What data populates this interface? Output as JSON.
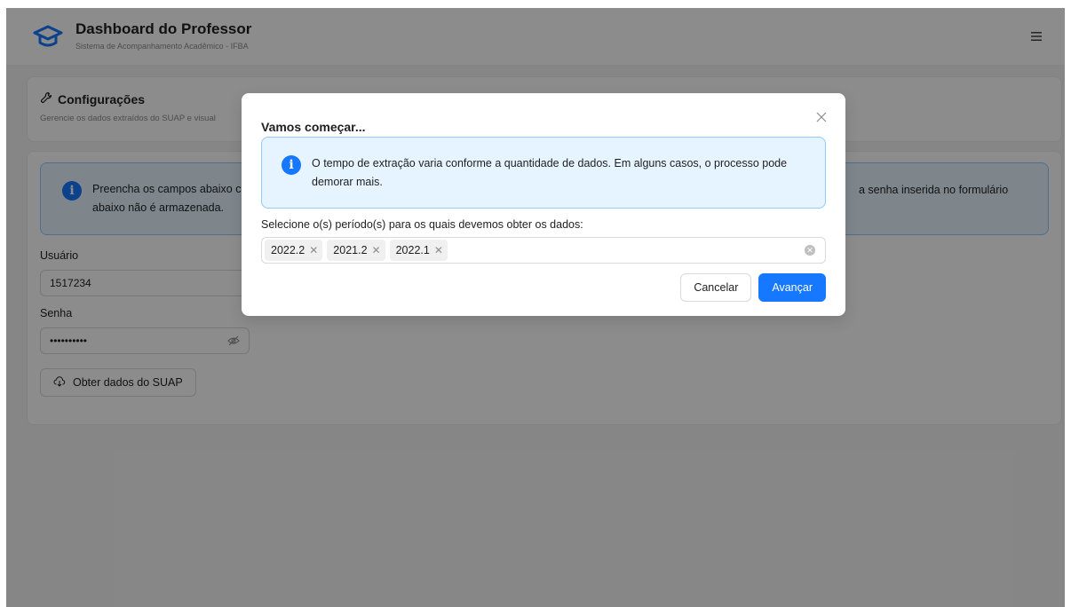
{
  "header": {
    "title": "Dashboard do Professor",
    "subtitle": "Sistema de Acompanhamento Acadêmico - IFBA",
    "logo_icon": "graduation-cap-icon",
    "menu_icon": "hamburger-icon"
  },
  "config_card": {
    "title": "Configurações",
    "description": "Gerencie os dados extraídos do SUAP e visual"
  },
  "form": {
    "alert_text_left": "Preencha os campos abaixo c",
    "alert_text_left_line2": "abaixo não é armazenada.",
    "alert_text_right": "a senha inserida no formulário",
    "user_label": "Usuário",
    "user_value": "1517234",
    "password_label": "Senha",
    "password_value": "••••••••••",
    "submit_label": "Obter dados do SUAP"
  },
  "modal": {
    "title": "Vamos começar...",
    "alert_text": "O tempo de extração varia conforme a quantidade de dados. Em alguns casos, o processo pode demorar mais.",
    "select_label": "Selecione o(s) período(s) para os quais devemos obter os dados:",
    "tags": [
      "2022.2",
      "2021.2",
      "2022.1"
    ],
    "cancel_label": "Cancelar",
    "next_label": "Avançar"
  },
  "colors": {
    "primary": "#1677ff",
    "info_bg": "#e6f4ff",
    "info_border": "#91caff"
  }
}
